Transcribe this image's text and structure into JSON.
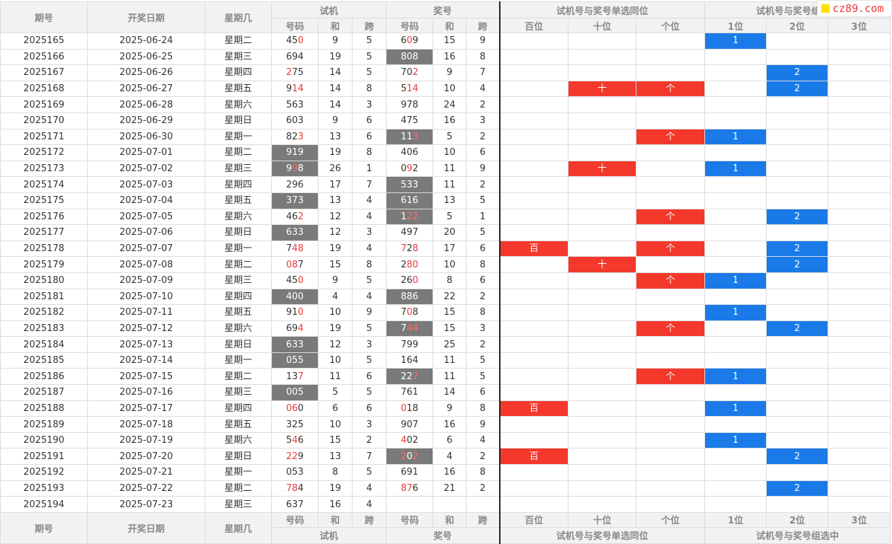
{
  "logo": "cz89.com",
  "colors": {
    "red_mark": "#f4382c",
    "blue_mark": "#1a7ae8",
    "highlight_cell": "#7a7a7a",
    "red_digit": "#e83a3a"
  },
  "header": {
    "issue": "期号",
    "date": "开奖日期",
    "weekday": "星期几",
    "trial_group": "试机",
    "draw_group": "奖号",
    "single_group": "试机号与奖号单选同位",
    "combo_group": "试机号与奖号组选中",
    "sub": {
      "code": "号码",
      "sum": "和",
      "span": "跨",
      "hundreds": "百位",
      "tens": "十位",
      "units": "个位",
      "p1": "1位",
      "p2": "2位",
      "p3": "3位"
    }
  },
  "rows": [
    {
      "issue": "2025165",
      "date": "2025-06-24",
      "weekday": "星期二",
      "trial": "450",
      "trial_hl": false,
      "trial_red": [
        2
      ],
      "trial_sum": "9",
      "trial_span": "5",
      "draw": "609",
      "draw_hl": false,
      "draw_red": [
        1
      ],
      "draw_sum": "15",
      "draw_span": "9",
      "bai": "",
      "shi": "",
      "ge": "",
      "c1": "1",
      "c2": "",
      "c3": ""
    },
    {
      "issue": "2025166",
      "date": "2025-06-25",
      "weekday": "星期三",
      "trial": "694",
      "trial_hl": false,
      "trial_red": [],
      "trial_sum": "19",
      "trial_span": "5",
      "draw": "808",
      "draw_hl": true,
      "draw_red": [],
      "draw_sum": "16",
      "draw_span": "8",
      "bai": "",
      "shi": "",
      "ge": "",
      "c1": "",
      "c2": "",
      "c3": ""
    },
    {
      "issue": "2025167",
      "date": "2025-06-26",
      "weekday": "星期四",
      "trial": "275",
      "trial_hl": false,
      "trial_red": [
        0
      ],
      "trial_sum": "14",
      "trial_span": "5",
      "draw": "702",
      "draw_hl": false,
      "draw_red": [
        2
      ],
      "draw_sum": "9",
      "draw_span": "7",
      "bai": "",
      "shi": "",
      "ge": "",
      "c1": "",
      "c2": "2",
      "c3": ""
    },
    {
      "issue": "2025168",
      "date": "2025-06-27",
      "weekday": "星期五",
      "trial": "914",
      "trial_hl": false,
      "trial_red": [
        1,
        2
      ],
      "trial_sum": "14",
      "trial_span": "8",
      "draw": "514",
      "draw_hl": false,
      "draw_red": [
        1,
        2
      ],
      "draw_sum": "10",
      "draw_span": "4",
      "bai": "",
      "shi": "十",
      "ge": "个",
      "c1": "",
      "c2": "2",
      "c3": ""
    },
    {
      "issue": "2025169",
      "date": "2025-06-28",
      "weekday": "星期六",
      "trial": "563",
      "trial_hl": false,
      "trial_red": [],
      "trial_sum": "14",
      "trial_span": "3",
      "draw": "978",
      "draw_hl": false,
      "draw_red": [],
      "draw_sum": "24",
      "draw_span": "2",
      "bai": "",
      "shi": "",
      "ge": "",
      "c1": "",
      "c2": "",
      "c3": ""
    },
    {
      "issue": "2025170",
      "date": "2025-06-29",
      "weekday": "星期日",
      "trial": "603",
      "trial_hl": false,
      "trial_red": [],
      "trial_sum": "9",
      "trial_span": "6",
      "draw": "475",
      "draw_hl": false,
      "draw_red": [],
      "draw_sum": "16",
      "draw_span": "3",
      "bai": "",
      "shi": "",
      "ge": "",
      "c1": "",
      "c2": "",
      "c3": ""
    },
    {
      "issue": "2025171",
      "date": "2025-06-30",
      "weekday": "星期一",
      "trial": "823",
      "trial_hl": false,
      "trial_red": [
        2
      ],
      "trial_sum": "13",
      "trial_span": "6",
      "draw": "113",
      "draw_hl": true,
      "draw_red": [
        2
      ],
      "draw_sum": "5",
      "draw_span": "2",
      "bai": "",
      "shi": "",
      "ge": "个",
      "c1": "1",
      "c2": "",
      "c3": ""
    },
    {
      "issue": "2025172",
      "date": "2025-07-01",
      "weekday": "星期二",
      "trial": "919",
      "trial_hl": true,
      "trial_red": [],
      "trial_sum": "19",
      "trial_span": "8",
      "draw": "406",
      "draw_hl": false,
      "draw_red": [],
      "draw_sum": "10",
      "draw_span": "6",
      "bai": "",
      "shi": "",
      "ge": "",
      "c1": "",
      "c2": "",
      "c3": ""
    },
    {
      "issue": "2025173",
      "date": "2025-07-02",
      "weekday": "星期三",
      "trial": "998",
      "trial_hl": true,
      "trial_red": [
        1
      ],
      "trial_sum": "26",
      "trial_span": "1",
      "draw": "092",
      "draw_hl": false,
      "draw_red": [
        1
      ],
      "draw_sum": "11",
      "draw_span": "9",
      "bai": "",
      "shi": "十",
      "ge": "",
      "c1": "1",
      "c2": "",
      "c3": ""
    },
    {
      "issue": "2025174",
      "date": "2025-07-03",
      "weekday": "星期四",
      "trial": "296",
      "trial_hl": false,
      "trial_red": [],
      "trial_sum": "17",
      "trial_span": "7",
      "draw": "533",
      "draw_hl": true,
      "draw_red": [],
      "draw_sum": "11",
      "draw_span": "2",
      "bai": "",
      "shi": "",
      "ge": "",
      "c1": "",
      "c2": "",
      "c3": ""
    },
    {
      "issue": "2025175",
      "date": "2025-07-04",
      "weekday": "星期五",
      "trial": "373",
      "trial_hl": true,
      "trial_red": [],
      "trial_sum": "13",
      "trial_span": "4",
      "draw": "616",
      "draw_hl": true,
      "draw_red": [],
      "draw_sum": "13",
      "draw_span": "5",
      "bai": "",
      "shi": "",
      "ge": "",
      "c1": "",
      "c2": "",
      "c3": ""
    },
    {
      "issue": "2025176",
      "date": "2025-07-05",
      "weekday": "星期六",
      "trial": "462",
      "trial_hl": false,
      "trial_red": [
        2
      ],
      "trial_sum": "12",
      "trial_span": "4",
      "draw": "122",
      "draw_hl": true,
      "draw_red": [
        1,
        2
      ],
      "draw_sum": "5",
      "draw_span": "1",
      "bai": "",
      "shi": "",
      "ge": "个",
      "c1": "",
      "c2": "2",
      "c3": ""
    },
    {
      "issue": "2025177",
      "date": "2025-07-06",
      "weekday": "星期日",
      "trial": "633",
      "trial_hl": true,
      "trial_red": [],
      "trial_sum": "12",
      "trial_span": "3",
      "draw": "497",
      "draw_hl": false,
      "draw_red": [],
      "draw_sum": "20",
      "draw_span": "5",
      "bai": "",
      "shi": "",
      "ge": "",
      "c1": "",
      "c2": "",
      "c3": ""
    },
    {
      "issue": "2025178",
      "date": "2025-07-07",
      "weekday": "星期一",
      "trial": "748",
      "trial_hl": false,
      "trial_red": [
        1,
        2
      ],
      "trial_sum": "19",
      "trial_span": "4",
      "draw": "728",
      "draw_hl": false,
      "draw_red": [
        0,
        2
      ],
      "draw_sum": "17",
      "draw_span": "6",
      "bai": "百",
      "shi": "",
      "ge": "个",
      "c1": "",
      "c2": "2",
      "c3": ""
    },
    {
      "issue": "2025179",
      "date": "2025-07-08",
      "weekday": "星期二",
      "trial": "087",
      "trial_hl": false,
      "trial_red": [
        0,
        1
      ],
      "trial_sum": "15",
      "trial_span": "8",
      "draw": "280",
      "draw_hl": false,
      "draw_red": [
        1,
        2
      ],
      "draw_sum": "10",
      "draw_span": "8",
      "bai": "",
      "shi": "十",
      "ge": "",
      "c1": "",
      "c2": "2",
      "c3": ""
    },
    {
      "issue": "2025180",
      "date": "2025-07-09",
      "weekday": "星期三",
      "trial": "450",
      "trial_hl": false,
      "trial_red": [
        2
      ],
      "trial_sum": "9",
      "trial_span": "5",
      "draw": "260",
      "draw_hl": false,
      "draw_red": [
        2
      ],
      "draw_sum": "8",
      "draw_span": "6",
      "bai": "",
      "shi": "",
      "ge": "个",
      "c1": "1",
      "c2": "",
      "c3": ""
    },
    {
      "issue": "2025181",
      "date": "2025-07-10",
      "weekday": "星期四",
      "trial": "400",
      "trial_hl": true,
      "trial_red": [],
      "trial_sum": "4",
      "trial_span": "4",
      "draw": "886",
      "draw_hl": true,
      "draw_red": [],
      "draw_sum": "22",
      "draw_span": "2",
      "bai": "",
      "shi": "",
      "ge": "",
      "c1": "",
      "c2": "",
      "c3": ""
    },
    {
      "issue": "2025182",
      "date": "2025-07-11",
      "weekday": "星期五",
      "trial": "910",
      "trial_hl": false,
      "trial_red": [
        2
      ],
      "trial_sum": "10",
      "trial_span": "9",
      "draw": "708",
      "draw_hl": false,
      "draw_red": [
        1
      ],
      "draw_sum": "15",
      "draw_span": "8",
      "bai": "",
      "shi": "",
      "ge": "",
      "c1": "1",
      "c2": "",
      "c3": ""
    },
    {
      "issue": "2025183",
      "date": "2025-07-12",
      "weekday": "星期六",
      "trial": "694",
      "trial_hl": false,
      "trial_red": [
        2
      ],
      "trial_sum": "19",
      "trial_span": "5",
      "draw": "744",
      "draw_hl": true,
      "draw_red": [
        1,
        2
      ],
      "draw_sum": "15",
      "draw_span": "3",
      "bai": "",
      "shi": "",
      "ge": "个",
      "c1": "",
      "c2": "2",
      "c3": ""
    },
    {
      "issue": "2025184",
      "date": "2025-07-13",
      "weekday": "星期日",
      "trial": "633",
      "trial_hl": true,
      "trial_red": [],
      "trial_sum": "12",
      "trial_span": "3",
      "draw": "799",
      "draw_hl": false,
      "draw_red": [],
      "draw_sum": "25",
      "draw_span": "2",
      "bai": "",
      "shi": "",
      "ge": "",
      "c1": "",
      "c2": "",
      "c3": ""
    },
    {
      "issue": "2025185",
      "date": "2025-07-14",
      "weekday": "星期一",
      "trial": "055",
      "trial_hl": true,
      "trial_red": [],
      "trial_sum": "10",
      "trial_span": "5",
      "draw": "164",
      "draw_hl": false,
      "draw_red": [],
      "draw_sum": "11",
      "draw_span": "5",
      "bai": "",
      "shi": "",
      "ge": "",
      "c1": "",
      "c2": "",
      "c3": ""
    },
    {
      "issue": "2025186",
      "date": "2025-07-15",
      "weekday": "星期二",
      "trial": "137",
      "trial_hl": false,
      "trial_red": [
        2
      ],
      "trial_sum": "11",
      "trial_span": "6",
      "draw": "227",
      "draw_hl": true,
      "draw_red": [
        2
      ],
      "draw_sum": "11",
      "draw_span": "5",
      "bai": "",
      "shi": "",
      "ge": "个",
      "c1": "1",
      "c2": "",
      "c3": ""
    },
    {
      "issue": "2025187",
      "date": "2025-07-16",
      "weekday": "星期三",
      "trial": "005",
      "trial_hl": true,
      "trial_red": [],
      "trial_sum": "5",
      "trial_span": "5",
      "draw": "761",
      "draw_hl": false,
      "draw_red": [],
      "draw_sum": "14",
      "draw_span": "6",
      "bai": "",
      "shi": "",
      "ge": "",
      "c1": "",
      "c2": "",
      "c3": ""
    },
    {
      "issue": "2025188",
      "date": "2025-07-17",
      "weekday": "星期四",
      "trial": "060",
      "trial_hl": false,
      "trial_red": [
        0,
        1
      ],
      "trial_sum": "6",
      "trial_span": "6",
      "draw": "018",
      "draw_hl": false,
      "draw_red": [
        0
      ],
      "draw_sum": "9",
      "draw_span": "8",
      "bai": "百",
      "shi": "",
      "ge": "",
      "c1": "1",
      "c2": "",
      "c3": ""
    },
    {
      "issue": "2025189",
      "date": "2025-07-18",
      "weekday": "星期五",
      "trial": "325",
      "trial_hl": false,
      "trial_red": [],
      "trial_sum": "10",
      "trial_span": "3",
      "draw": "907",
      "draw_hl": false,
      "draw_red": [],
      "draw_sum": "16",
      "draw_span": "9",
      "bai": "",
      "shi": "",
      "ge": "",
      "c1": "",
      "c2": "",
      "c3": ""
    },
    {
      "issue": "2025190",
      "date": "2025-07-19",
      "weekday": "星期六",
      "trial": "546",
      "trial_hl": false,
      "trial_red": [
        1
      ],
      "trial_sum": "15",
      "trial_span": "2",
      "draw": "402",
      "draw_hl": false,
      "draw_red": [
        0
      ],
      "draw_sum": "6",
      "draw_span": "4",
      "bai": "",
      "shi": "",
      "ge": "",
      "c1": "1",
      "c2": "",
      "c3": ""
    },
    {
      "issue": "2025191",
      "date": "2025-07-20",
      "weekday": "星期日",
      "trial": "229",
      "trial_hl": false,
      "trial_red": [
        0,
        1
      ],
      "trial_sum": "13",
      "trial_span": "7",
      "draw": "202",
      "draw_hl": true,
      "draw_red": [
        0,
        2
      ],
      "draw_sum": "4",
      "draw_span": "2",
      "bai": "百",
      "shi": "",
      "ge": "",
      "c1": "",
      "c2": "2",
      "c3": ""
    },
    {
      "issue": "2025192",
      "date": "2025-07-21",
      "weekday": "星期一",
      "trial": "053",
      "trial_hl": false,
      "trial_red": [],
      "trial_sum": "8",
      "trial_span": "5",
      "draw": "691",
      "draw_hl": false,
      "draw_red": [],
      "draw_sum": "16",
      "draw_span": "8",
      "bai": "",
      "shi": "",
      "ge": "",
      "c1": "",
      "c2": "",
      "c3": ""
    },
    {
      "issue": "2025193",
      "date": "2025-07-22",
      "weekday": "星期二",
      "trial": "784",
      "trial_hl": false,
      "trial_red": [
        0,
        1
      ],
      "trial_sum": "19",
      "trial_span": "4",
      "draw": "876",
      "draw_hl": false,
      "draw_red": [
        0,
        1
      ],
      "draw_sum": "21",
      "draw_span": "2",
      "bai": "",
      "shi": "",
      "ge": "",
      "c1": "",
      "c2": "2",
      "c3": ""
    },
    {
      "issue": "2025194",
      "date": "2025-07-23",
      "weekday": "星期三",
      "trial": "637",
      "trial_hl": false,
      "trial_red": [],
      "trial_sum": "16",
      "trial_span": "4",
      "draw": "",
      "draw_hl": false,
      "draw_red": [],
      "draw_sum": "",
      "draw_span": "",
      "bai": "",
      "shi": "",
      "ge": "",
      "c1": "",
      "c2": "",
      "c3": ""
    }
  ]
}
